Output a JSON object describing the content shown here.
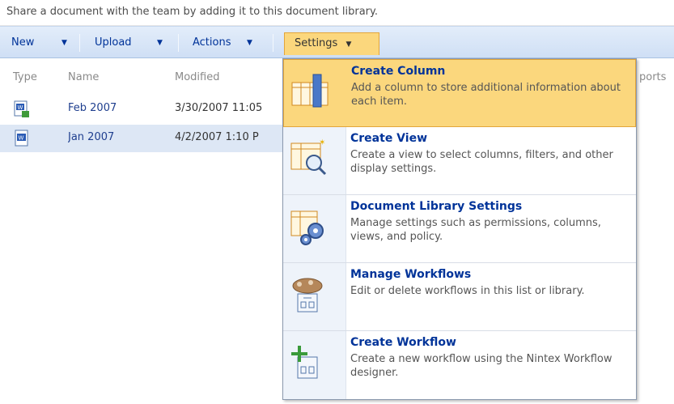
{
  "description": "Share a document with the team by adding it to this document library.",
  "toolbar": {
    "new_label": "New",
    "upload_label": "Upload",
    "actions_label": "Actions",
    "settings_label": "Settings",
    "arrow": "▼"
  },
  "columns": [
    "Type",
    "Name",
    "Modified",
    "ports"
  ],
  "rows": [
    {
      "name": "Feb 2007",
      "modified": "3/30/2007 11:05",
      "icon": "word-document-new-icon"
    },
    {
      "name": "Jan 2007",
      "modified": "4/2/2007 1:10 P",
      "icon": "word-document-icon"
    }
  ],
  "menu": {
    "items": [
      {
        "title": "Create Column",
        "desc": "Add a column to store additional information about each item.",
        "icon": "create-column-icon"
      },
      {
        "title": "Create View",
        "desc": "Create a view to select columns, filters, and other display settings.",
        "icon": "create-view-icon"
      },
      {
        "title": "Document Library Settings",
        "desc": "Manage settings such as permissions, columns, views, and policy.",
        "icon": "library-settings-icon"
      },
      {
        "title": "Manage Workflows",
        "desc": "Edit or delete workflows in this list or library.",
        "icon": "manage-workflows-icon"
      },
      {
        "title": "Create Workflow",
        "desc": "Create a new workflow using the Nintex Workflow designer.",
        "icon": "create-workflow-icon"
      }
    ]
  },
  "colors": {
    "accent": "#003399",
    "highlight": "#fbd77d",
    "toolbar": "#d8e5f7"
  }
}
